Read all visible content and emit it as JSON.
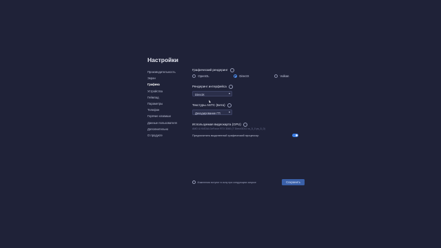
{
  "page": {
    "title": "Настройки"
  },
  "sidebar": {
    "items": [
      {
        "label": "Производительность"
      },
      {
        "label": "Экран"
      },
      {
        "label": "Графика"
      },
      {
        "label": "Устройства"
      },
      {
        "label": "Геймпад"
      },
      {
        "label": "Параметры"
      },
      {
        "label": "Телефон"
      },
      {
        "label": "Горячие клавиши"
      },
      {
        "label": "Данные пользователя"
      },
      {
        "label": "Дополнительно"
      },
      {
        "label": "О продукте"
      }
    ],
    "active_index": 2
  },
  "graphics": {
    "renderer": {
      "label": "Графический рендеринг",
      "options": [
        "OpenGL",
        "DirectX",
        "Vulkan"
      ],
      "selected": "DirectX"
    },
    "ui_renderer": {
      "label": "Рендеринг интерфейса",
      "value": "DirectX"
    },
    "astc": {
      "label": "Текстуры ASTC (Бета)",
      "value": "Декодирование ГП"
    },
    "gpu": {
      "label": "Используемая видеокарта (GPU)",
      "name": "AMD & NVIDIA GeForce RTX 3060 (T Direct3D11 vs_5_0 ps_5_0)",
      "prefer_label": "Предпочитать выделенный графический процессор",
      "prefer_enabled": true
    }
  },
  "footer": {
    "note": "Изменения вступят в силу при следующем запуске",
    "save_label": "Сохранить"
  },
  "colors": {
    "background": "#1f2238",
    "accent": "#3c7fe6",
    "button": "#3a60a8"
  }
}
